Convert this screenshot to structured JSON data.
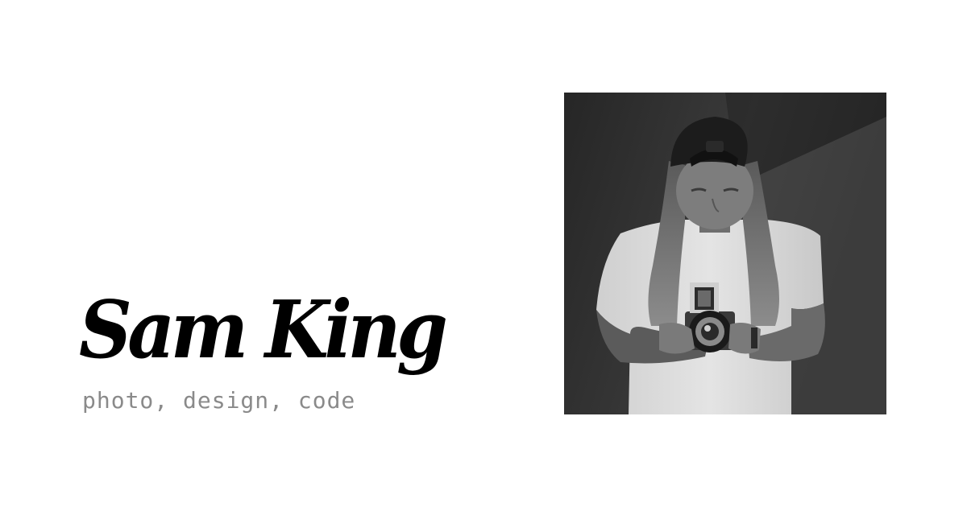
{
  "profile": {
    "name": "Sam King",
    "tagline": "photo, design, code"
  },
  "photo": {
    "subject": "black-and-white portrait of a person with long hair and a backwards cap looking down into a medium-format camera held at the chest"
  },
  "colors": {
    "background": "#ffffff",
    "name_text": "#000000",
    "tagline_text": "#8a8a8a"
  }
}
